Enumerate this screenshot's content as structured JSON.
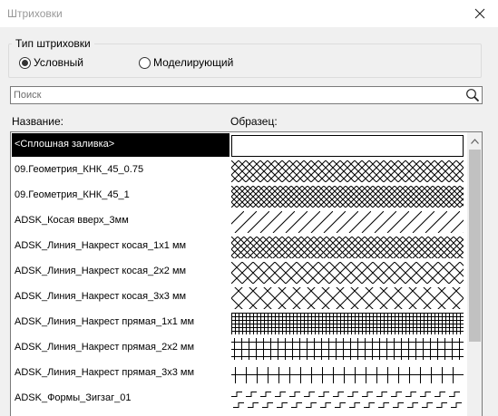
{
  "window": {
    "title": "Штриховки"
  },
  "hatch_type": {
    "label": "Тип штриховки",
    "options": [
      {
        "label": "Условный",
        "selected": true
      },
      {
        "label": "Моделирующий",
        "selected": false
      }
    ]
  },
  "search": {
    "placeholder": "Поиск",
    "value": "",
    "icon": "magnifier-icon"
  },
  "columns": {
    "name": "Название:",
    "sample": "Образец:"
  },
  "hatches": [
    {
      "name": "<Сплошная заливка>",
      "pattern": "solid",
      "selected": true
    },
    {
      "name": "09.Геометрия_КНК_45_0.75",
      "pattern": "cross-diagonal-fine"
    },
    {
      "name": "09.Геометрия_КНК_45_1",
      "pattern": "cross-diagonal-finer"
    },
    {
      "name": "ADSK_Косая вверх_3мм",
      "pattern": "diagonal-up"
    },
    {
      "name": "ADSK_Линия_Накрест косая_1х1 мм",
      "pattern": "cross-diagonal-1"
    },
    {
      "name": "ADSK_Линия_Накрест косая_2х2 мм",
      "pattern": "cross-diagonal-2"
    },
    {
      "name": "ADSK_Линия_Накрест косая_3х3 мм",
      "pattern": "cross-diagonal-3"
    },
    {
      "name": "ADSK_Линия_Накрест прямая_1х1 мм",
      "pattern": "grid-1"
    },
    {
      "name": "ADSK_Линия_Накрест прямая_2х2 мм",
      "pattern": "grid-2"
    },
    {
      "name": "ADSK_Линия_Накрест прямая_3х3 мм",
      "pattern": "grid-3"
    },
    {
      "name": "ADSK_Формы_Зигзаг_01",
      "pattern": "zigzag"
    }
  ],
  "scrollbar": {
    "up_icon": "chevron-up-icon"
  }
}
